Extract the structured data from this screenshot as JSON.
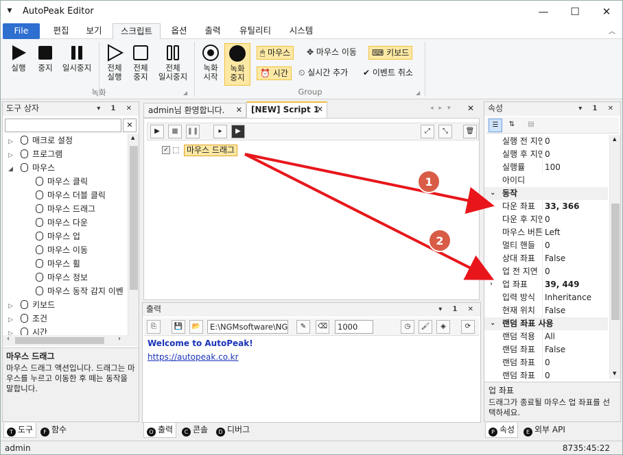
{
  "window": {
    "title": "AutoPeak Editor",
    "minimize": "—",
    "maximize": "☐",
    "close": "✕",
    "menu_glyph": "▼"
  },
  "ribbon_tabs": [
    "File",
    "편집",
    "보기",
    "스크립트",
    "옵션",
    "출력",
    "유틸리티",
    "시스템"
  ],
  "ribbon": {
    "group1": {
      "run": "실행",
      "stop": "중지",
      "pause": "일시중지",
      "run_all": [
        "전체",
        "실행"
      ],
      "stop_all": [
        "전체",
        "중지"
      ],
      "pause_all": [
        "전체",
        "일시중지"
      ],
      "label": "녹화"
    },
    "group2": {
      "record_start": [
        "녹화",
        "시작"
      ],
      "record_stop": [
        "녹화",
        "중지"
      ],
      "mouse": "마우스",
      "mouse_move": "마우스 이동",
      "keyboard": "키보드",
      "time": "시간",
      "realtime_add": "실시간 추가",
      "event_cancel": "이벤트 취소",
      "label": "Group"
    }
  },
  "toolbox": {
    "title": "도구 상자",
    "search_value": "",
    "tree": [
      {
        "label": "매크로 설정",
        "expander": "▷",
        "icon": "globe-icon"
      },
      {
        "label": "프로그램",
        "expander": "▷",
        "icon": "monitor-icon"
      },
      {
        "label": "마우스",
        "expander": "◢",
        "icon": "mouse-icon"
      },
      {
        "label": "마우스 클릭",
        "child": true,
        "icon": "mouse-click-icon"
      },
      {
        "label": "마우스 더블 클릭",
        "child": true,
        "icon": "mouse-double-click-icon"
      },
      {
        "label": "마우스 드래그",
        "child": true,
        "icon": "mouse-drag-icon"
      },
      {
        "label": "마우스 다운",
        "child": true,
        "icon": "mouse-down-icon"
      },
      {
        "label": "마우스 업",
        "child": true,
        "icon": "mouse-up-icon"
      },
      {
        "label": "마우스 이동",
        "child": true,
        "icon": "move-arrows-icon"
      },
      {
        "label": "마우스 휠",
        "child": true,
        "icon": "mouse-wheel-icon"
      },
      {
        "label": "마우스 정보",
        "child": true,
        "icon": "mouse-info-icon"
      },
      {
        "label": "마우스 동작 감지 이벤",
        "child": true,
        "icon": "lightning-icon"
      },
      {
        "label": "키보드",
        "expander": "▷",
        "icon": "keyboard-icon"
      },
      {
        "label": "조건",
        "expander": "▷",
        "icon": "condition-icon"
      },
      {
        "label": "시간",
        "expander": "▷",
        "icon": "calendar-icon"
      }
    ],
    "desc_title": "마우스 드래그",
    "desc_text": "마우스 드래그 액션입니다. 드래그는 마우스를 누르고 이동한 후 떼는 동작을 말합니다.",
    "tabs": [
      {
        "label": "도구",
        "badge": "T"
      },
      {
        "label": "함수",
        "badge": "F"
      }
    ]
  },
  "editor": {
    "tabs": [
      {
        "label": "admin님 환영합니다."
      },
      {
        "label": "[NEW] Script 1"
      }
    ],
    "script_item": "마우스 드래그"
  },
  "output": {
    "title": "출력",
    "path": "E:\\NGMsoftware\\NG",
    "count": "1000",
    "welcome": "Welcome to AutoPeak!",
    "link": "https://autopeak.co.kr",
    "tabs": [
      {
        "label": "출력",
        "badge": "O"
      },
      {
        "label": "콘솔",
        "badge": "C"
      },
      {
        "label": "디버그",
        "badge": "D"
      }
    ]
  },
  "properties": {
    "title": "속성",
    "rows": [
      {
        "k": "실행 전 지연",
        "v": "0"
      },
      {
        "k": "실행 후 지연",
        "v": "0"
      },
      {
        "k": "실행률",
        "v": "100"
      },
      {
        "k": "아이디",
        "v": ""
      },
      {
        "k": "동작",
        "cat": true,
        "exp": "⌄"
      },
      {
        "k": "다운 좌표",
        "v": "33, 366",
        "bold": true,
        "exp": "›"
      },
      {
        "k": "다운 후 지연",
        "v": "0"
      },
      {
        "k": "마우스 버튼",
        "v": "Left"
      },
      {
        "k": "멀티 핸들",
        "v": "0"
      },
      {
        "k": "상대 좌표",
        "v": "False"
      },
      {
        "k": "업 전 지연",
        "v": "0"
      },
      {
        "k": "업 좌표",
        "v": "39, 449",
        "bold": true,
        "exp": "›"
      },
      {
        "k": "입력 방식",
        "v": "Inheritance"
      },
      {
        "k": "현재 위치",
        "v": "False"
      },
      {
        "k": "랜덤 좌표 사용",
        "cat": true,
        "exp": "⌄"
      },
      {
        "k": "랜덤 적용",
        "v": "All"
      },
      {
        "k": "랜덤 좌표",
        "v": "False"
      },
      {
        "k": "랜덤 좌표",
        "v": "0"
      },
      {
        "k": "랜덤 좌표",
        "v": "0"
      }
    ],
    "desc_title": "업 좌표",
    "desc_text": "드래그가 종료될 마우스 업 좌표를 선택하세요.",
    "tabs": [
      {
        "label": "속성",
        "badge": "P"
      },
      {
        "label": "외부 API",
        "badge": "E"
      }
    ]
  },
  "annotations": [
    "1",
    "2"
  ],
  "status": {
    "user": "admin",
    "time": "8735:45:22"
  },
  "colors": {
    "accent": "#2e6fd0",
    "highlight": "#fde9a4",
    "arrow": "#e8161b"
  }
}
